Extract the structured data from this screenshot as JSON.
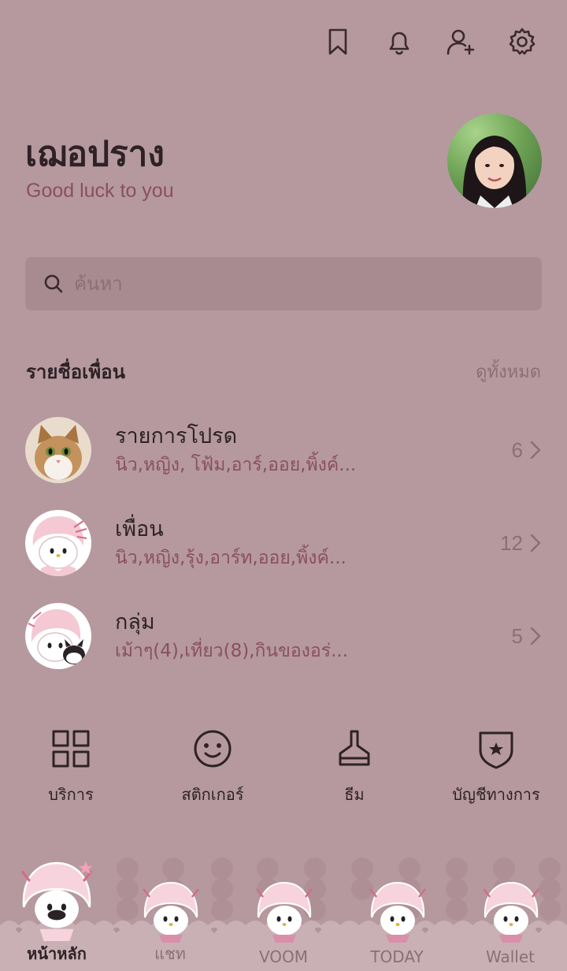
{
  "topbar": {
    "icons": [
      "bookmark-icon",
      "bell-icon",
      "add-friend-icon",
      "settings-gear-icon"
    ]
  },
  "profile": {
    "name": "เฌอปราง",
    "status": "Good luck to you"
  },
  "search": {
    "placeholder": "ค้นหา"
  },
  "friends_section": {
    "title": "รายชื่อเพื่อน",
    "see_all": "ดูทั้งหมด",
    "rows": [
      {
        "title": "รายการโปรด",
        "subtitle": "นิว,หญิง, โฟ้ม,อาร์,ออย,พิ้งค์...",
        "count": "6"
      },
      {
        "title": "เพื่อน",
        "subtitle": "นิว,หญิง,รุ้ง,อาร์ท,ออย,พิ้งค์...",
        "count": "12"
      },
      {
        "title": "กลุ่ม",
        "subtitle": "เม้าๆ(4),เที่ยว(8),กินของอร่...",
        "count": "5"
      }
    ]
  },
  "shortcuts": [
    {
      "label": "บริการ",
      "icon": "grid-icon"
    },
    {
      "label": "สติกเกอร์",
      "icon": "smiley-icon"
    },
    {
      "label": "ธีม",
      "icon": "brush-icon"
    },
    {
      "label": "บัญชีทางการ",
      "icon": "shield-star-icon"
    }
  ],
  "bottom_nav": [
    {
      "label": "หน้าหลัก",
      "active": true
    },
    {
      "label": "แชท",
      "active": false
    },
    {
      "label": "VOOM",
      "active": false
    },
    {
      "label": "TODAY",
      "active": false
    },
    {
      "label": "Wallet",
      "active": false
    }
  ],
  "colors": {
    "background": "#b5999f",
    "accent_text": "#8a4f60",
    "muted_text": "#8c6f76",
    "search_bg": "#a88b91"
  }
}
